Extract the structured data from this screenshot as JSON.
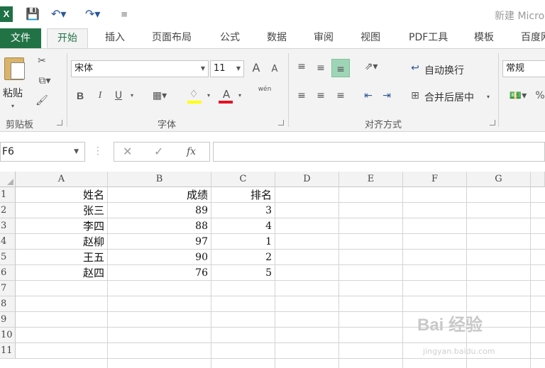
{
  "title_bar": {
    "doc_title": "新建 Micro"
  },
  "tabs": [
    "开始",
    "插入",
    "页面布局",
    "公式",
    "数据",
    "审阅",
    "视图",
    "PDF工具",
    "模板",
    "百度网"
  ],
  "file_tab": "文件",
  "ribbon": {
    "clipboard": {
      "paste_label": "粘贴",
      "group_label": "剪贴板"
    },
    "font": {
      "font_name": "宋体",
      "font_size": "11",
      "group_label": "字体",
      "bold": "B",
      "italic": "I",
      "underline": "U",
      "grow": "A",
      "shrink": "A",
      "phonetic": "wén"
    },
    "alignment": {
      "wrap_text": "自动换行",
      "merge_center": "合并后居中",
      "group_label": "对齐方式"
    },
    "number": {
      "format": "常规"
    }
  },
  "formula_bar": {
    "name_box": "F6",
    "fx": "fx",
    "formula": ""
  },
  "grid": {
    "columns": [
      "A",
      "B",
      "C",
      "D",
      "E",
      "F",
      "G"
    ],
    "rows": [
      "1",
      "2",
      "3",
      "4",
      "5",
      "6",
      "7",
      "8",
      "9",
      "10",
      "11"
    ],
    "table": [
      {
        "name": "姓名",
        "score": "成绩",
        "rank": "排名"
      },
      {
        "name": "张三",
        "score": "89",
        "rank": "3"
      },
      {
        "name": "李四",
        "score": "88",
        "rank": "4"
      },
      {
        "name": "赵柳",
        "score": "97",
        "rank": "1"
      },
      {
        "name": "王五",
        "score": "90",
        "rank": "2"
      },
      {
        "name": "赵四",
        "score": "76",
        "rank": "5"
      }
    ]
  },
  "watermark": {
    "text": "Bai 经验",
    "sub": "jingyan.baidu.com"
  },
  "colors": {
    "excel_green": "#217346",
    "highlight": "#9fd5b7"
  }
}
